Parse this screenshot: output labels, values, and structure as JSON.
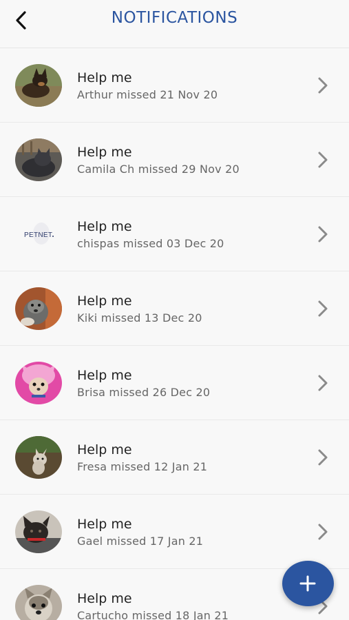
{
  "header": {
    "title": "NOTIFICATIONS",
    "back_icon": "chevron-left-icon"
  },
  "colors": {
    "accent": "#2b55a0",
    "title_text": "#222222",
    "subtitle_text": "#666666",
    "chevron": "#8a8a8a",
    "background": "#f8f8f8"
  },
  "notifications": [
    {
      "title": "Help me",
      "subtitle": "Arthur missed 21 Nov 20",
      "avatar": "dog-photo-avatar"
    },
    {
      "title": "Help me",
      "subtitle": "Camila Ch missed 29 Nov 20",
      "avatar": "cat-photo-avatar"
    },
    {
      "title": "Help me",
      "subtitle": "chispas missed 03 Dec 20",
      "avatar": "petnet-logo-avatar",
      "avatar_text": "PETNET"
    },
    {
      "title": "Help me",
      "subtitle": "Kiki missed 13 Dec 20",
      "avatar": "dog-photo-avatar"
    },
    {
      "title": "Help me",
      "subtitle": "Brisa missed 26 Dec 20",
      "avatar": "dog-costume-photo-avatar"
    },
    {
      "title": "Help me",
      "subtitle": "Fresa missed 12 Jan 21",
      "avatar": "dog-photo-avatar"
    },
    {
      "title": "Help me",
      "subtitle": "Gael missed 17 Jan 21",
      "avatar": "dog-photo-avatar"
    },
    {
      "title": "Help me",
      "subtitle": "Cartucho missed 18 Jan 21",
      "avatar": "dog-photo-avatar"
    }
  ],
  "fab": {
    "icon": "plus-icon"
  }
}
